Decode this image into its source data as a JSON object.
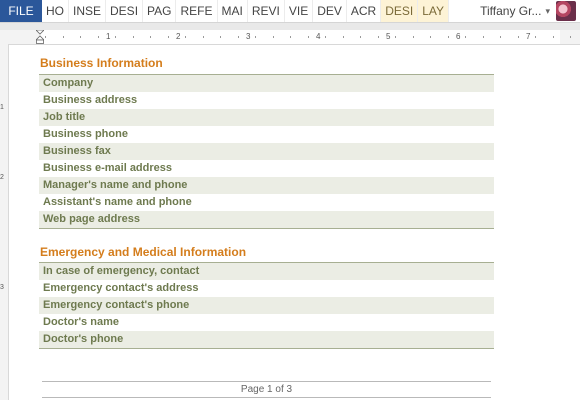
{
  "ribbon": {
    "file_label": "FILE",
    "tabs": [
      "HO",
      "INSE",
      "DESI",
      "PAG",
      "REFE",
      "MAI",
      "REVI",
      "VIE",
      "DEV",
      "ACR"
    ],
    "context_tabs": [
      "DESI",
      "LAY"
    ],
    "user_name": "Tiffany Gr..."
  },
  "ruler": {
    "numbers": [
      "1",
      "2",
      "3",
      "4",
      "5",
      "6",
      "7"
    ]
  },
  "vertical_ruler": {
    "numbers": [
      "1",
      "2",
      "3"
    ]
  },
  "business": {
    "title": "Business Information",
    "rows": [
      "Company",
      "Business address",
      "Job title",
      "Business phone",
      "Business fax",
      "Business e-mail address",
      "Manager's name and phone",
      "Assistant's name and phone",
      "Web page address"
    ]
  },
  "emergency": {
    "title": "Emergency and Medical Information",
    "rows": [
      "In case of emergency, contact",
      "Emergency contact's address",
      "Emergency contact's phone",
      "Doctor's name",
      "Doctor's phone"
    ]
  },
  "footer": {
    "page_text": "Page 1 of 3"
  }
}
